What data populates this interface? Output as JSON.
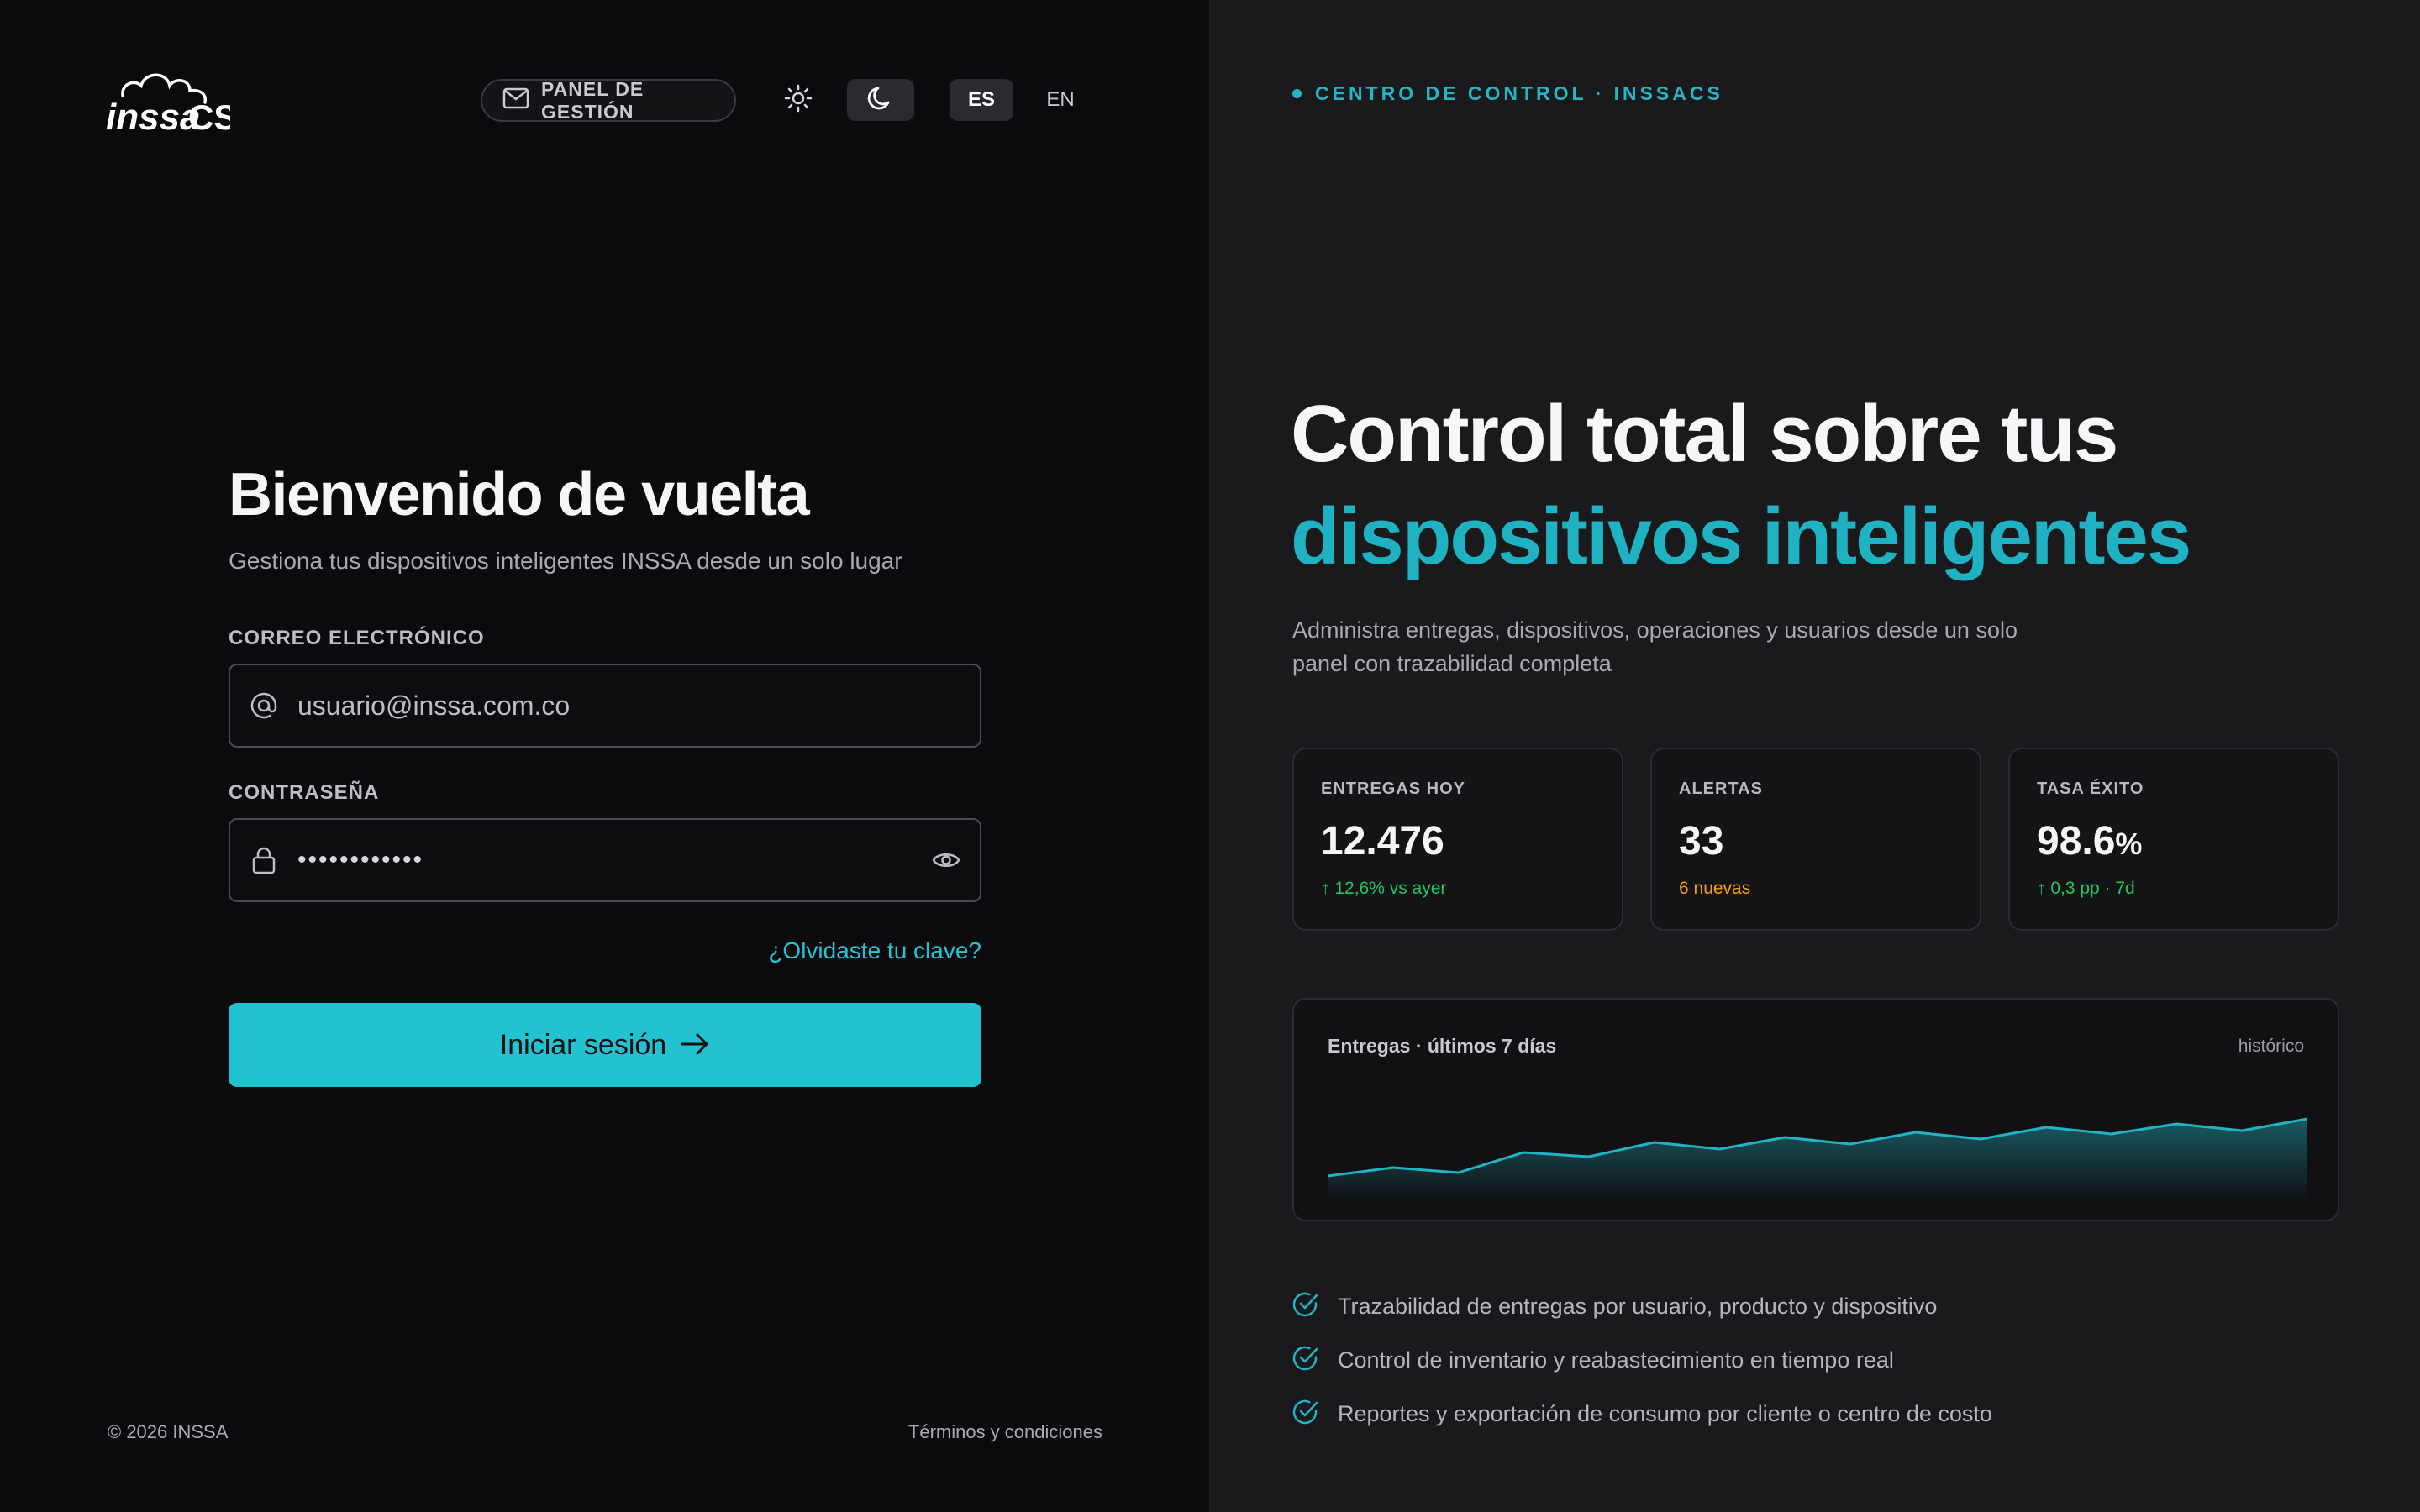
{
  "brand": {
    "logo_text": "inssa CS"
  },
  "topbar": {
    "panel_label": "PANEL DE GESTIÓN",
    "theme_light": "sun-icon",
    "theme_dark": "moon-icon",
    "lang_es": "ES",
    "lang_en": "EN",
    "active_lang": "ES"
  },
  "login": {
    "title": "Bienvenido de vuelta",
    "subtitle": "Gestiona tus dispositivos inteligentes INSSA desde un solo lugar",
    "email_label": "CORREO ELECTRÓNICO",
    "email_placeholder": "usuario@inssa.com.co",
    "password_label": "CONTRASEÑA",
    "password_value": "••••••••••••",
    "forgot": "¿Olvidaste tu clave?",
    "submit": "Iniciar sesión"
  },
  "footer": {
    "copyright": "© 2026 INSSA",
    "terms": "Términos y condiciones"
  },
  "hero": {
    "kicker": "CENTRO DE CONTROL · INSSACS",
    "title_line1": "Control total sobre tus",
    "title_line2": "dispositivos inteligentes",
    "description": "Administra entregas, dispositivos, operaciones y usuarios desde un solo panel con trazabilidad completa"
  },
  "stats": [
    {
      "label": "ENTREGAS HOY",
      "value": "12.476",
      "unit": "",
      "delta": "↑ 12,6% vs ayer",
      "delta_color": "#22c55e"
    },
    {
      "label": "ALERTAS",
      "value": "33",
      "unit": "",
      "delta": "6 nuevas",
      "delta_color": "#f59e0b"
    },
    {
      "label": "TASA ÉXITO",
      "value": "98.6",
      "unit": "%",
      "delta": "↑ 0,3 pp · 7d",
      "delta_color": "#22c55e"
    }
  ],
  "chart_panel": {
    "title": "Entregas · últimos 7 días",
    "range_label": "histórico"
  },
  "chart_data": {
    "type": "area",
    "title": "Entregas · últimos 7 días",
    "values": [
      30,
      40,
      34,
      58,
      53,
      70,
      62,
      76,
      68,
      82,
      74,
      88,
      80,
      92,
      84,
      98
    ],
    "ylim": [
      0,
      130
    ],
    "grid": false,
    "color": "#22b3c3"
  },
  "features": [
    "Trazabilidad de entregas por usuario, producto y dispositivo",
    "Control de inventario y reabastecimiento en tiempo real",
    "Reportes y exportación de consumo por cliente o centro de costo"
  ],
  "colors": {
    "accent": "#23c2d1",
    "bg_left": "#0b0b0d",
    "bg_right": "#1a1a1d"
  }
}
